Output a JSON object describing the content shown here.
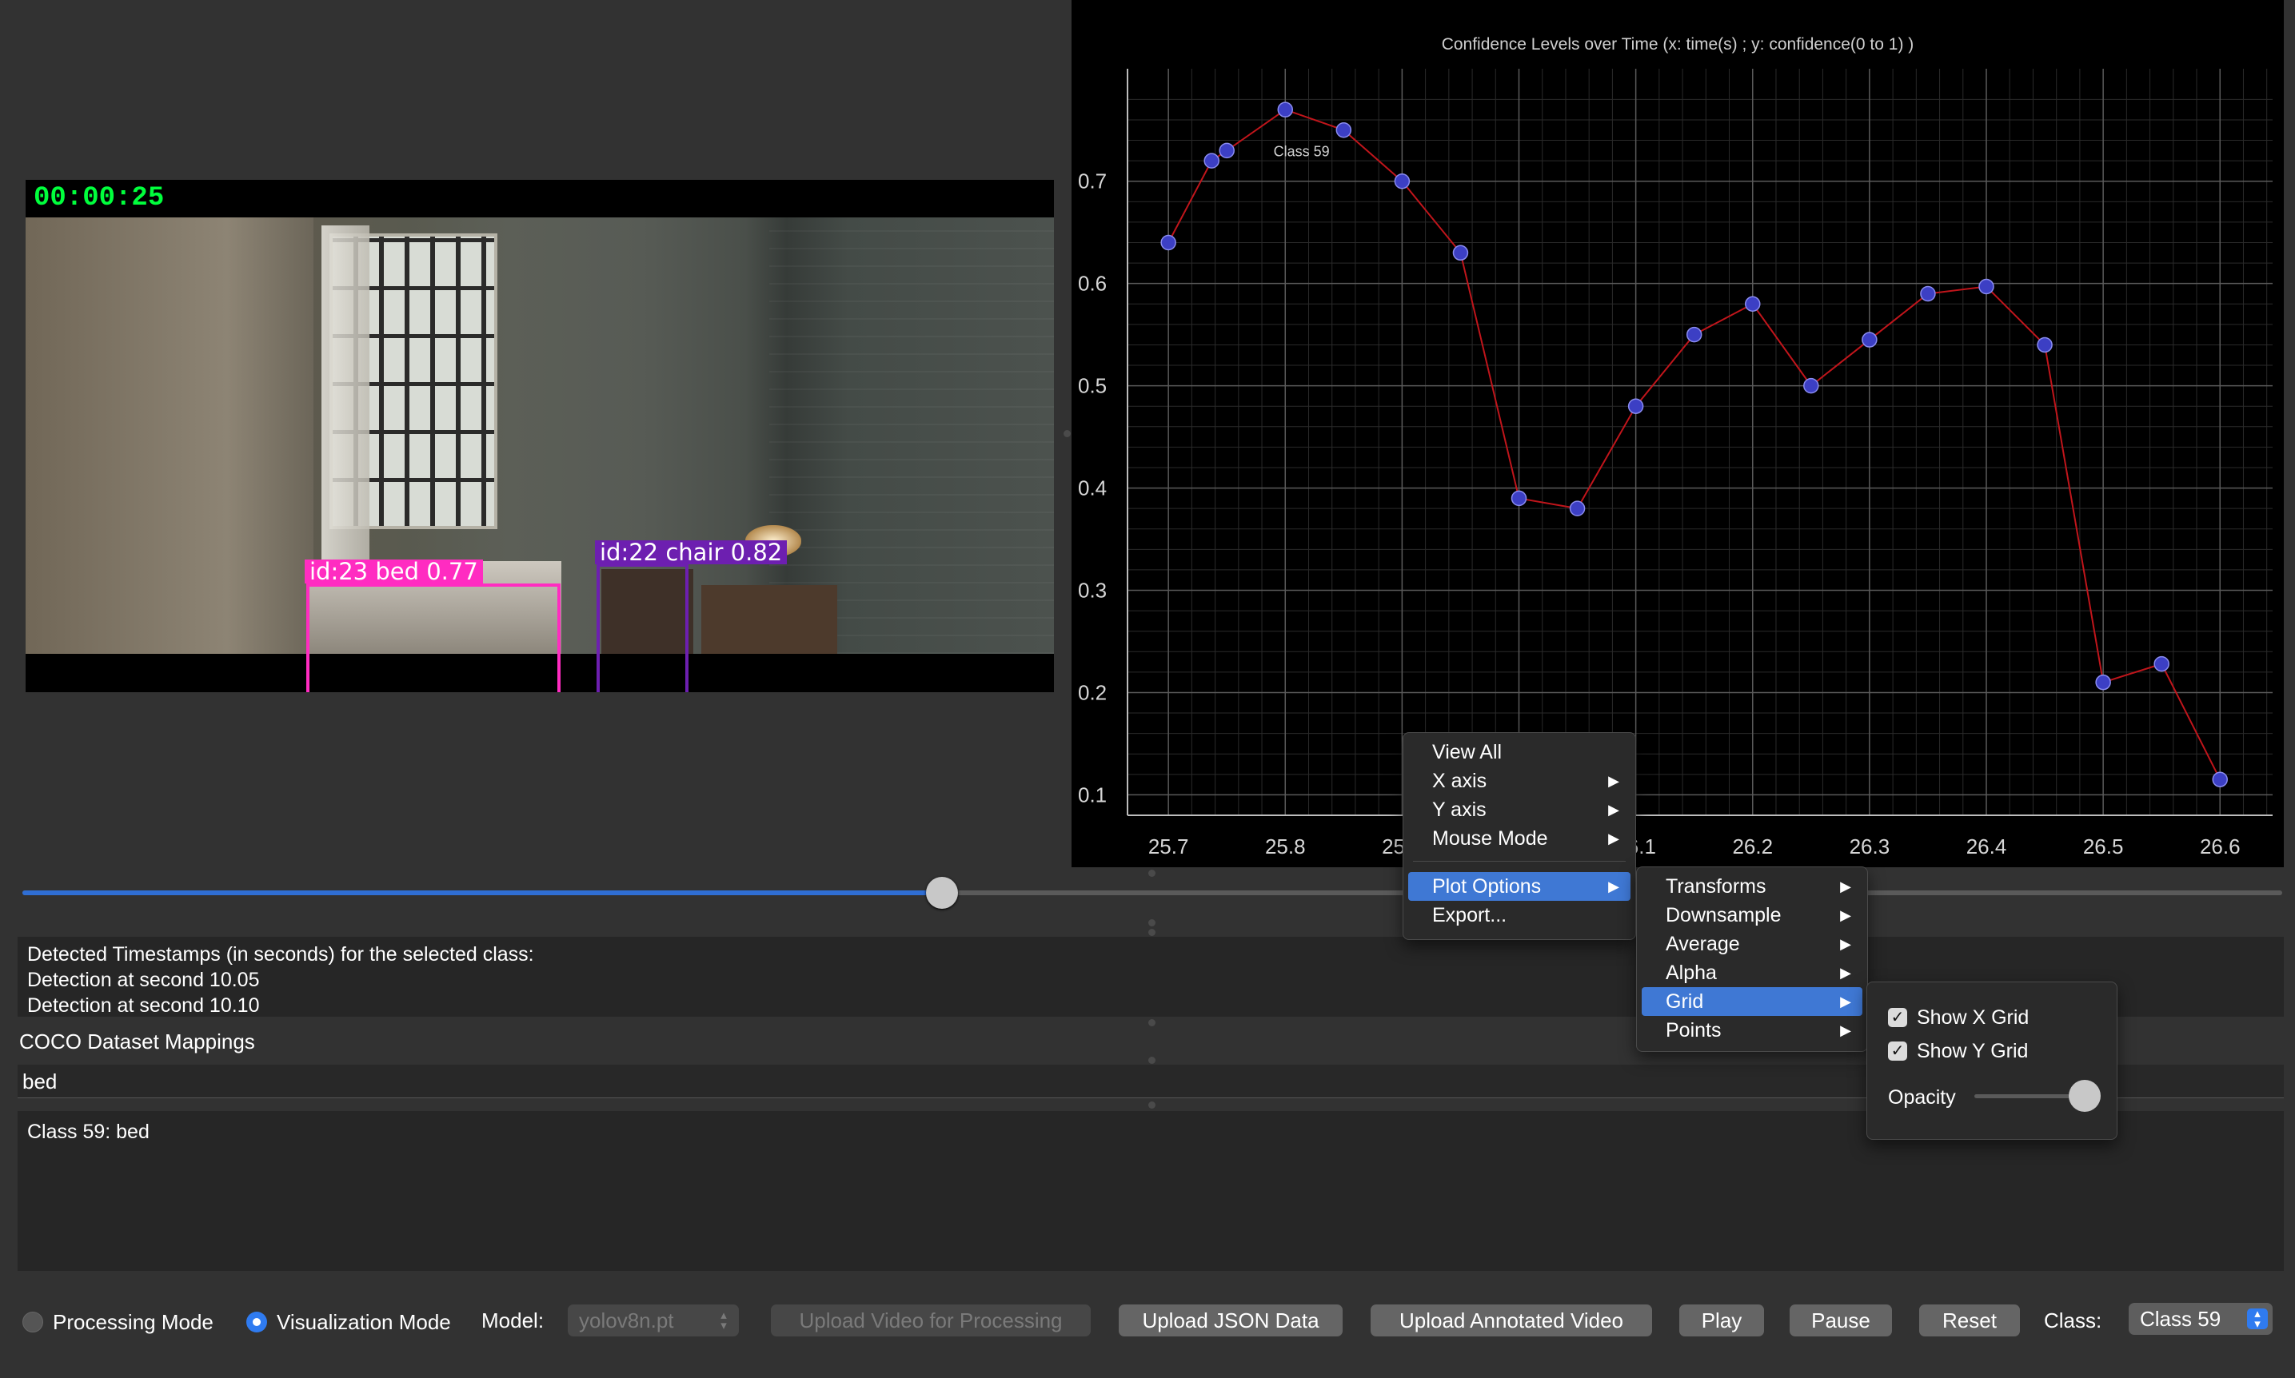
{
  "video": {
    "timecode": "00:00:25",
    "detections": [
      {
        "label": "id:23  bed  0.77",
        "color": "#ff2cc1"
      },
      {
        "label": "id:22  chair  0.82",
        "color": "#6d1fb0"
      }
    ]
  },
  "chart_data": {
    "type": "line",
    "title": "Confidence Levels over Time (x: time(s) ; y: confidence(0 to 1) )",
    "xlabel": "",
    "ylabel": "",
    "xlim": [
      25.665,
      26.645
    ],
    "ylim": [
      0.08,
      0.81
    ],
    "x_ticks": [
      "25.7",
      "25.8",
      "25.9",
      "26",
      "26.1",
      "26.2",
      "26.3",
      "26.4",
      "26.5",
      "26.6"
    ],
    "y_ticks": [
      "0.1",
      "0.2",
      "0.3",
      "0.4",
      "0.5",
      "0.6",
      "0.7"
    ],
    "grid": true,
    "line_color": "#c0151b",
    "point_color": "#3c3fc4",
    "annotation": "Class 59",
    "series": [
      {
        "x": [
          25.7,
          25.737,
          25.75,
          25.8,
          25.85,
          25.9,
          25.95,
          26.0,
          26.05,
          26.1,
          26.15,
          26.2,
          26.25,
          26.3,
          26.35,
          26.4,
          26.45,
          26.5,
          26.55,
          26.6
        ],
        "values": [
          0.64,
          0.72,
          0.73,
          0.77,
          0.75,
          0.7,
          0.63,
          0.39,
          0.38,
          0.48,
          0.55,
          0.58,
          0.5,
          0.545,
          0.59,
          0.597,
          0.54,
          0.21,
          0.228,
          0.115
        ]
      }
    ]
  },
  "timestamps": {
    "header": "Detected Timestamps (in seconds) for the selected class:",
    "lines": [
      "Detection at second 10.05",
      "Detection at second 10.10"
    ]
  },
  "coco": {
    "label": "COCO Dataset Mappings",
    "search_value": "bed",
    "mapping_text": "Class 59: bed"
  },
  "toolbar": {
    "processing_mode": "Processing Mode",
    "visualization_mode": "Visualization Mode",
    "model_label": "Model:",
    "model_value": "yolov8n.pt",
    "upload_video": "Upload Video for Processing",
    "upload_json": "Upload JSON Data",
    "upload_annotated": "Upload Annotated Video",
    "play": "Play",
    "pause": "Pause",
    "reset": "Reset",
    "class_label": "Class:",
    "class_value": "Class 59"
  },
  "context_menu": {
    "items": [
      "View All",
      "X axis",
      "Y axis",
      "Mouse Mode",
      "Plot Options",
      "Export..."
    ],
    "plot_options": [
      "Transforms",
      "Downsample",
      "Average",
      "Alpha",
      "Grid",
      "Points"
    ],
    "grid": {
      "show_x": "Show X Grid",
      "show_y": "Show Y Grid",
      "opacity": "Opacity",
      "opacity_value": 1.0
    }
  },
  "colors": {
    "accent": "#2f7bf0",
    "menu_highlight": "#3f78d4"
  }
}
